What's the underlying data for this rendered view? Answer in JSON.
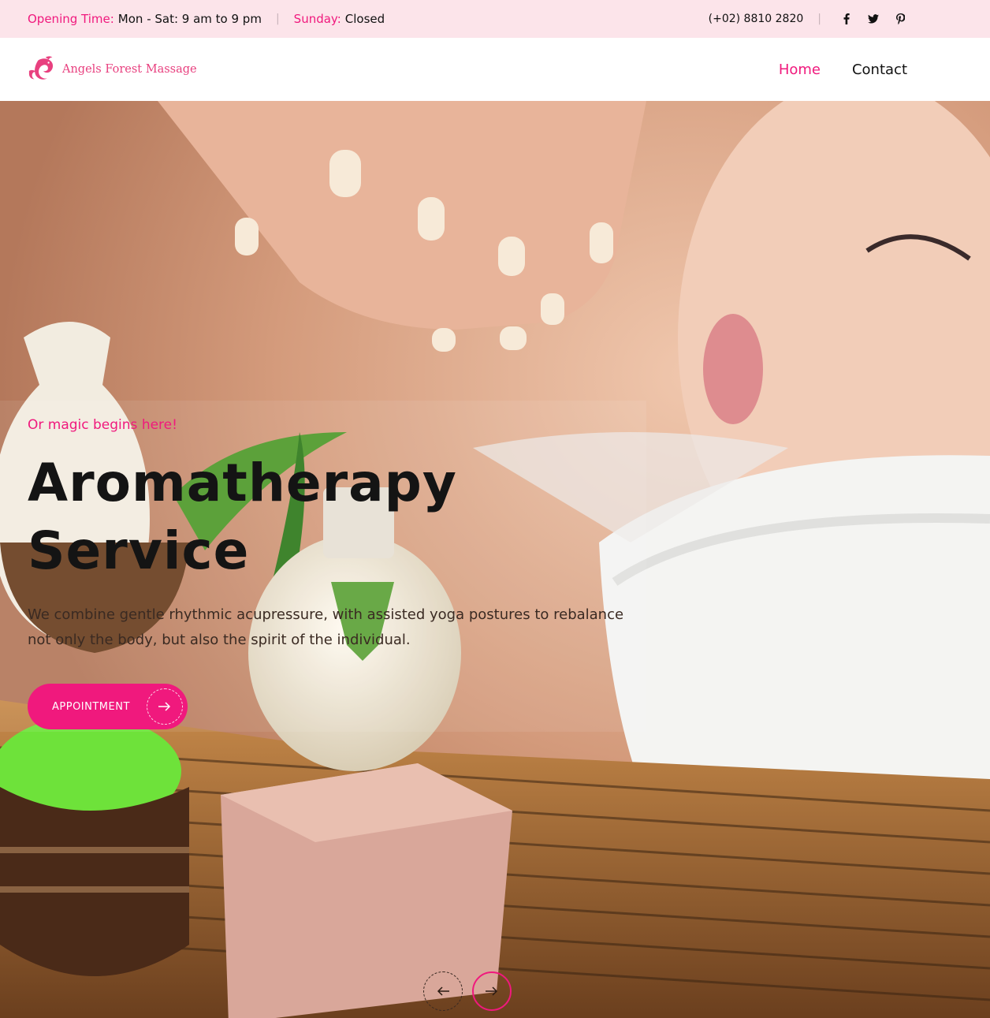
{
  "topbar": {
    "opening_label": "Opening Time:",
    "opening_value": "Mon - Sat: 9 am to 9 pm",
    "sunday_label": "Sunday:",
    "sunday_value": "Closed",
    "phone": "(+02) 8810 2820",
    "social_icons": [
      "facebook-icon",
      "twitter-icon",
      "pinterest-icon"
    ]
  },
  "header": {
    "logo_text": "Angels Forest Massage",
    "nav": [
      {
        "label": "Home",
        "active": true
      },
      {
        "label": "Contact",
        "active": false
      }
    ]
  },
  "hero": {
    "tagline": "Or magic begins here!",
    "title_line1": "Aromatherapy",
    "title_line2": "Service",
    "description": "We combine gentle rhythmic acupressure, with assisted yoga postures to rebalance not only the body, but also the spirit of the individual.",
    "cta_label": "APPOINTMENT",
    "cta_icon": "arrow-right-icon",
    "prev_icon": "arrow-left-icon",
    "next_icon": "arrow-right-icon"
  },
  "colors": {
    "accent": "#f0197d",
    "topbar_bg": "#fce4ea",
    "text_dark": "#111111"
  }
}
